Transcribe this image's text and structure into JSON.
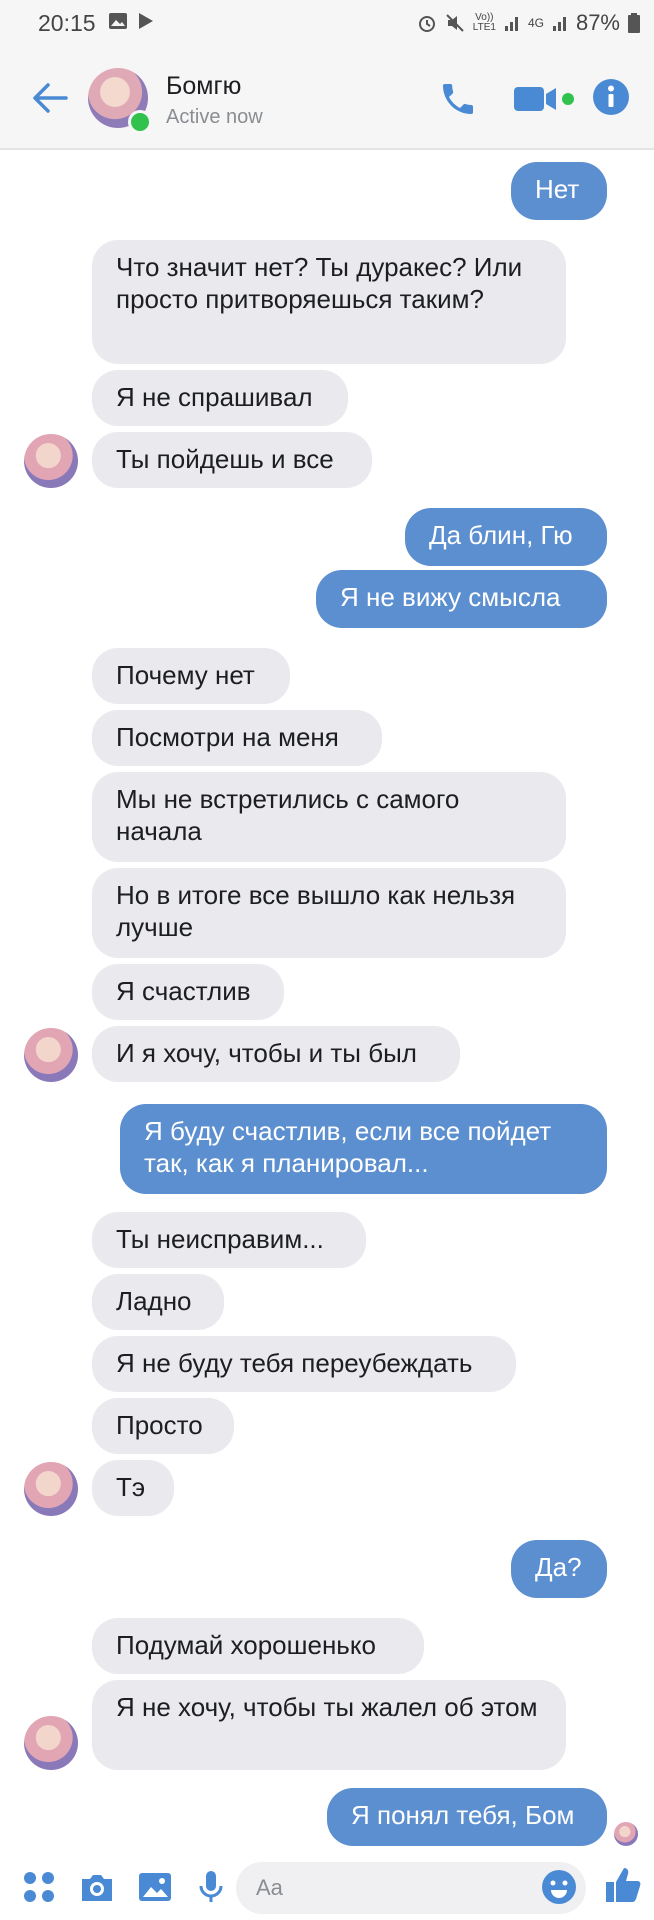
{
  "status_bar": {
    "time": "20:15",
    "volte_top": "Vo))",
    "volte_bottom": "LTE1",
    "network": "4G",
    "battery": "87%"
  },
  "header": {
    "name": "Бомгю",
    "status": "Active now"
  },
  "messages": [
    {
      "side": "out",
      "text": "Нет"
    },
    {
      "side": "in",
      "text": "Что значит нет? Ты дуракес? Или просто притворяешься таким?"
    },
    {
      "side": "in",
      "text": "Я не спрашивал"
    },
    {
      "side": "in",
      "text": "Ты пойдешь и все"
    },
    {
      "side": "out",
      "text": "Да блин, Гю"
    },
    {
      "side": "out",
      "text": "Я не вижу смысла"
    },
    {
      "side": "in",
      "text": "Почему нет"
    },
    {
      "side": "in",
      "text": "Посмотри на меня"
    },
    {
      "side": "in",
      "text": "Мы не встретились с самого начала"
    },
    {
      "side": "in",
      "text": "Но в итоге все вышло как нельзя лучше"
    },
    {
      "side": "in",
      "text": "Я счастлив"
    },
    {
      "side": "in",
      "text": "И я хочу, чтобы и ты был"
    },
    {
      "side": "out",
      "text": "Я буду счастлив, если все пойдет так, как я планировал..."
    },
    {
      "side": "in",
      "text": "Ты неисправим..."
    },
    {
      "side": "in",
      "text": "Ладно"
    },
    {
      "side": "in",
      "text": "Я не буду тебя переубеждать"
    },
    {
      "side": "in",
      "text": "Просто"
    },
    {
      "side": "in",
      "text": "Тэ"
    },
    {
      "side": "out",
      "text": "Да?"
    },
    {
      "side": "in",
      "text": "Подумай хорошенько"
    },
    {
      "side": "in",
      "text": "Я не хочу, чтобы ты жалел об этом"
    },
    {
      "side": "out",
      "text": "Я понял тебя, Бом"
    }
  ],
  "composer": {
    "placeholder": "Aa"
  },
  "colors": {
    "accent": "#4a8ad4",
    "outgoing_bubble": "#5c8fcf",
    "incoming_bubble": "#e9e9ee",
    "online": "#31c24d"
  }
}
